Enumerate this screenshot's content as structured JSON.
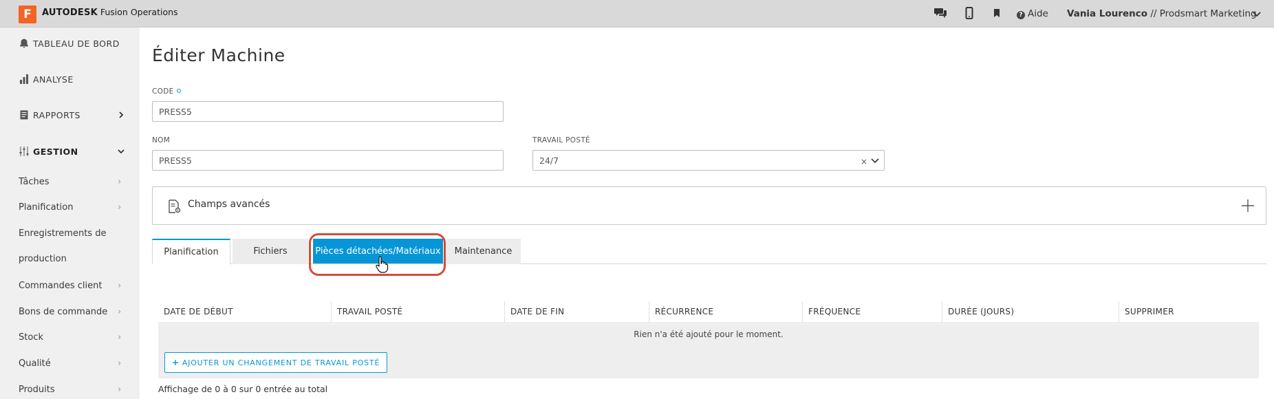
{
  "header": {
    "logo_letter": "F",
    "brand_bold": "AUTODESK",
    "brand_product": "Fusion Operations",
    "help_label": "Aide",
    "help_icon": "question-circle-icon",
    "user_name": "Vania Lourenco",
    "user_org": " // Prodsmart Marketing",
    "icons": [
      "chat-icon",
      "mobile-icon",
      "bookmark-icon"
    ]
  },
  "sidebar": {
    "top_items": [
      {
        "label": "TABLEAU DE BORD",
        "icon": "bell-icon"
      },
      {
        "label": "ANALYSE",
        "icon": "bar-chart-icon"
      },
      {
        "label": "RAPPORTS",
        "icon": "report-icon"
      },
      {
        "label": "GESTION",
        "icon": "sliders-icon"
      }
    ],
    "sub_items": [
      {
        "label": "Tâches"
      },
      {
        "label": "Planification"
      },
      {
        "label": "Enregistrements de"
      },
      {
        "label": "production"
      },
      {
        "label": "Commandes client"
      },
      {
        "label": "Bons de commande"
      },
      {
        "label": "Stock"
      },
      {
        "label": "Qualité"
      },
      {
        "label": "Produits"
      }
    ]
  },
  "form": {
    "title": "Éditer Machine",
    "code_label": "CODE",
    "code_value": "PRESS5",
    "name_label": "NOM",
    "name_value": "PRESS5",
    "shift_label": "TRAVAIL POSTÉ",
    "shift_value": "24/7",
    "shift_clear": "×",
    "advanced_label": "Champs avancés"
  },
  "tabs": [
    {
      "label": "Planification",
      "active": true
    },
    {
      "label": "Fichiers"
    },
    {
      "label": "Pièces détachées/Matériaux",
      "highlighted": true
    },
    {
      "label": "Maintenance"
    }
  ],
  "table": {
    "columns": [
      "DATE DE DÉBUT",
      "TRAVAIL POSTÉ",
      "DATE DE FIN",
      "RÉCURRENCE",
      "FRÉQUENCE",
      "DURÉE (JOURS)",
      "SUPPRIMER"
    ],
    "empty_message": "Rien n'a été ajouté pour le moment.",
    "add_button": "AJOUTER UN CHANGEMENT DE TRAVAIL POSTÉ",
    "footer": "Affichage de 0 à 0 sur 0 entrée au total"
  },
  "colors": {
    "accent": "#0696d7",
    "brand": "#f26522",
    "highlight": "#d84a38"
  }
}
